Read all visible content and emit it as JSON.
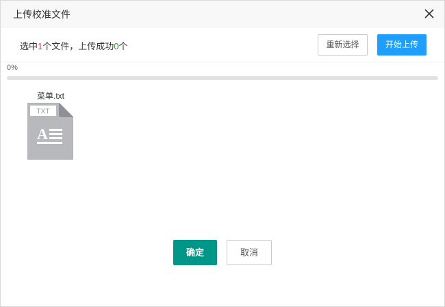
{
  "dialog": {
    "title": "上传校准文件"
  },
  "summary": {
    "prefix": "选中",
    "selected_count": "1",
    "middle": "个文件，上传成功",
    "success_count": "0",
    "suffix": "个"
  },
  "toolbar": {
    "reselect_label": "重新选择",
    "start_label": "开始上传"
  },
  "progress": {
    "label": "0%",
    "value": 0
  },
  "files": [
    {
      "name": "菜单.txt",
      "type_badge": "TXT",
      "icon": "txt-file-icon"
    }
  ],
  "footer": {
    "ok_label": "确定",
    "cancel_label": "取消"
  },
  "colors": {
    "primary_blue": "#1e9fff",
    "confirm_green": "#009688",
    "count_red": "#e4393c",
    "count_green": "#1aad19"
  }
}
